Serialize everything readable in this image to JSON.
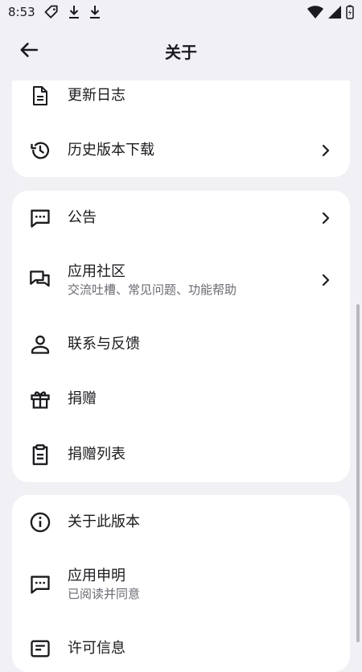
{
  "status_bar": {
    "time": "8:53"
  },
  "app_bar": {
    "title": "关于"
  },
  "card1": {
    "items": [
      {
        "title": "更新日志",
        "icon": "document-icon"
      },
      {
        "title": "历史版本下载",
        "icon": "history-icon"
      }
    ]
  },
  "card2": {
    "items": [
      {
        "title": "公告",
        "icon": "chat-icon"
      },
      {
        "title": "应用社区",
        "subtitle": "交流吐槽、常见问题、功能帮助",
        "icon": "forum-icon"
      },
      {
        "title": "联系与反馈",
        "icon": "person-icon"
      },
      {
        "title": "捐赠",
        "icon": "gift-icon"
      },
      {
        "title": "捐赠列表",
        "icon": "clipboard-icon"
      }
    ]
  },
  "card3": {
    "items": [
      {
        "title": "关于此版本",
        "icon": "info-icon"
      },
      {
        "title": "应用申明",
        "subtitle": "已阅读并同意",
        "icon": "chat-icon"
      },
      {
        "title": "许可信息",
        "icon": "license-icon"
      }
    ]
  }
}
